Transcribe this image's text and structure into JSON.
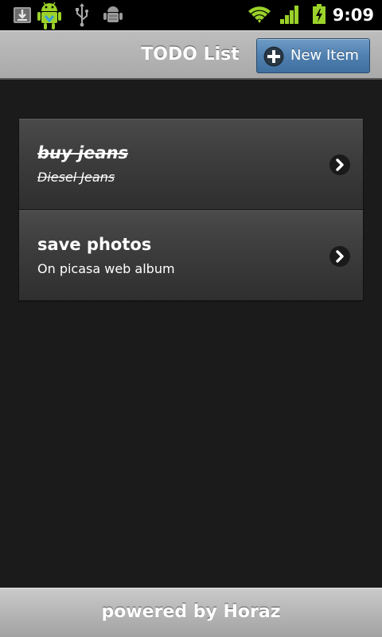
{
  "status_bar": {
    "time": "9:09",
    "left_icons": [
      "download-icon",
      "android-robot-icon",
      "usb-icon",
      "debug-bug-icon"
    ],
    "right_icons": [
      "wifi-icon",
      "signal-icon",
      "battery-charging-icon"
    ],
    "accent_green": "#9bd22a"
  },
  "header": {
    "title": "TODO List",
    "new_item_label": "New Item",
    "button_color": "#4f80b0"
  },
  "items": [
    {
      "title": "buy jeans",
      "description": "Diesel Jeans",
      "done": true
    },
    {
      "title": "save photos",
      "description": "On picasa web album",
      "done": false
    }
  ],
  "footer": {
    "text": "powered by Horaz"
  }
}
